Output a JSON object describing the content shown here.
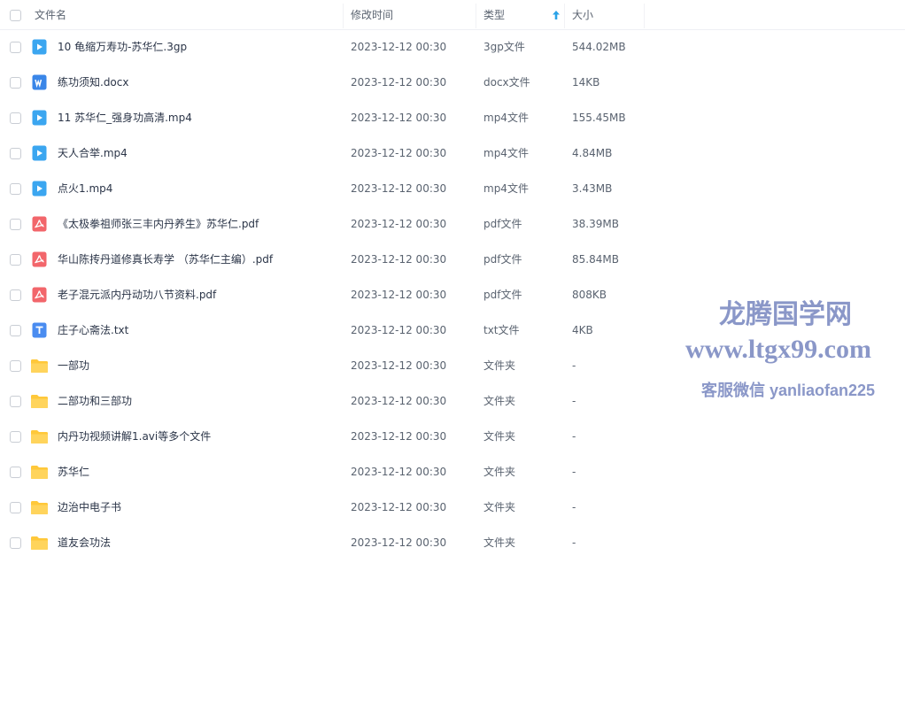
{
  "header": {
    "name": "文件名",
    "time": "修改时间",
    "type": "类型",
    "size": "大小"
  },
  "colors": {
    "video": "#3ba6f0",
    "word": "#3a86e8",
    "pdf": "#f2666b",
    "txt": "#4a8cf0",
    "folder": "#ffc83a",
    "sort_arrow": "#2aa3e8",
    "watermark": "#8a97c8"
  },
  "files": [
    {
      "icon": "video-file-icon",
      "name": "10 龟缩万寿功-苏华仁.3gp",
      "time": "2023-12-12 00:30",
      "type": "3gp文件",
      "size": "544.02MB"
    },
    {
      "icon": "word-file-icon",
      "name": "练功须知.docx",
      "time": "2023-12-12 00:30",
      "type": "docx文件",
      "size": "14KB"
    },
    {
      "icon": "video-file-icon",
      "name": "11 苏华仁_强身功高清.mp4",
      "time": "2023-12-12 00:30",
      "type": "mp4文件",
      "size": "155.45MB"
    },
    {
      "icon": "video-file-icon",
      "name": "天人合举.mp4",
      "time": "2023-12-12 00:30",
      "type": "mp4文件",
      "size": "4.84MB"
    },
    {
      "icon": "video-file-icon",
      "name": "点火1.mp4",
      "time": "2023-12-12 00:30",
      "type": "mp4文件",
      "size": "3.43MB"
    },
    {
      "icon": "pdf-file-icon",
      "name": "《太极拳祖师张三丰内丹养生》苏华仁.pdf",
      "time": "2023-12-12 00:30",
      "type": "pdf文件",
      "size": "38.39MB"
    },
    {
      "icon": "pdf-file-icon",
      "name": "华山陈抟丹道修真长寿学 （苏华仁主编）.pdf",
      "time": "2023-12-12 00:30",
      "type": "pdf文件",
      "size": "85.84MB"
    },
    {
      "icon": "pdf-file-icon",
      "name": "老子混元派内丹动功八节资料.pdf",
      "time": "2023-12-12 00:30",
      "type": "pdf文件",
      "size": "808KB"
    },
    {
      "icon": "txt-file-icon",
      "name": "庄子心斋法.txt",
      "time": "2023-12-12 00:30",
      "type": "txt文件",
      "size": "4KB"
    },
    {
      "icon": "folder-icon",
      "name": "一部功",
      "time": "2023-12-12 00:30",
      "type": "文件夹",
      "size": "-"
    },
    {
      "icon": "folder-icon",
      "name": "二部功和三部功",
      "time": "2023-12-12 00:30",
      "type": "文件夹",
      "size": "-"
    },
    {
      "icon": "folder-icon",
      "name": "内丹功视频讲解1.avi等多个文件",
      "time": "2023-12-12 00:30",
      "type": "文件夹",
      "size": "-"
    },
    {
      "icon": "folder-icon",
      "name": "苏华仁",
      "time": "2023-12-12 00:30",
      "type": "文件夹",
      "size": "-"
    },
    {
      "icon": "folder-icon",
      "name": "边治中电子书",
      "time": "2023-12-12 00:30",
      "type": "文件夹",
      "size": "-"
    },
    {
      "icon": "folder-icon",
      "name": "道友会功法",
      "time": "2023-12-12 00:30",
      "type": "文件夹",
      "size": "-"
    }
  ],
  "watermark": {
    "line1": "龙腾国学网",
    "line2": "www.ltgx99.com",
    "line3": "客服微信 yanliaofan225"
  }
}
